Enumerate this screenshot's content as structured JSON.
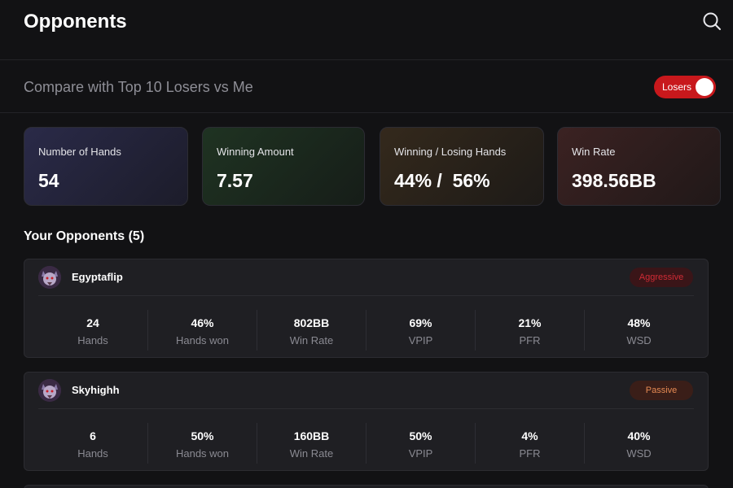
{
  "header": {
    "title": "Opponents",
    "search_icon": "search-icon"
  },
  "compare": {
    "label": "Compare with Top 10 Losers vs Me",
    "toggle_label": "Losers",
    "toggle_on": true,
    "toggle_color": "#c8181c"
  },
  "stats": {
    "hands": {
      "label": "Number of Hands",
      "value": "54"
    },
    "winning": {
      "label": "Winning Amount",
      "value": "7.57"
    },
    "win_lose": {
      "label": "Winning / Losing Hands",
      "value": "44% /  56%"
    },
    "win_rate": {
      "label": "Win Rate",
      "value": "398.56BB"
    }
  },
  "opponents_section": {
    "title": "Your Opponents (5)"
  },
  "opponents": [
    {
      "name": "Egyptaflip",
      "badge": "Aggressive",
      "avatar_icon": "wolf-avatar-icon",
      "stats": [
        {
          "value": "24",
          "label": "Hands"
        },
        {
          "value": "46%",
          "label": "Hands won"
        },
        {
          "value": "802BB",
          "label": "Win Rate"
        },
        {
          "value": "69%",
          "label": "VPIP"
        },
        {
          "value": "21%",
          "label": "PFR"
        },
        {
          "value": "48%",
          "label": "WSD"
        }
      ]
    },
    {
      "name": "Skyhighh",
      "badge": "Passive",
      "avatar_icon": "wolf-avatar-icon",
      "stats": [
        {
          "value": "6",
          "label": "Hands"
        },
        {
          "value": "50%",
          "label": "Hands won"
        },
        {
          "value": "160BB",
          "label": "Win Rate"
        },
        {
          "value": "50%",
          "label": "VPIP"
        },
        {
          "value": "4%",
          "label": "PFR"
        },
        {
          "value": "40%",
          "label": "WSD"
        }
      ]
    }
  ]
}
